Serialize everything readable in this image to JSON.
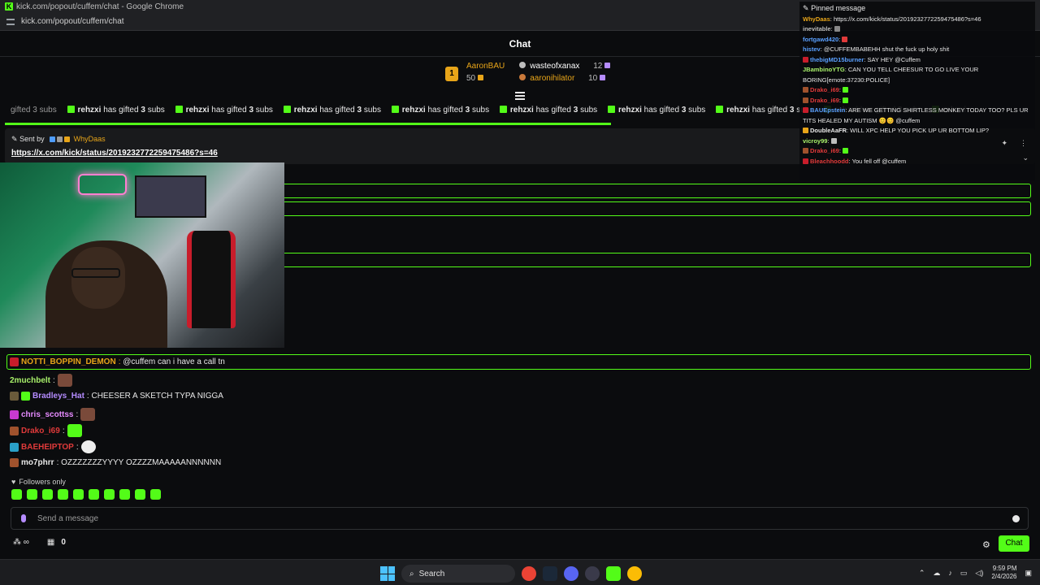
{
  "browser": {
    "title": "kick.com/popout/cuffem/chat - Google Chrome",
    "url": "kick.com/popout/cuffem/chat"
  },
  "chat": {
    "header": "Chat",
    "leaderboard": {
      "first": {
        "name": "AaronBAU",
        "count": "50",
        "rank": "1"
      },
      "second": {
        "name": "wasteofxanax",
        "count": "12"
      },
      "third": {
        "name": "aaronihilator",
        "count": "10"
      }
    },
    "ticker": {
      "prefix": "gifted 3 subs",
      "gifter": "rehzxi",
      "text": "has gifted",
      "count": "3",
      "unit": "subs",
      "tail": "rehzxi"
    },
    "pinned": {
      "sent_by_label": "Sent by",
      "sender": "WhyDaas",
      "link": "https://x.com/kick/status/2019232772259475486?s=46"
    },
    "messages": [
      {
        "user": "NOTTI_BOPPIN_DEMON",
        "color": "#e8a519",
        "text": "@cuffem can i have a call tn",
        "highlight": true
      },
      {
        "user": "2muchbelt",
        "color": "#a8f06a",
        "text": "",
        "emote": true
      },
      {
        "user": "Bradleys_Hat",
        "color": "#b58cff",
        "text": "CHEESER A SKETCH TYPA NIGGA"
      },
      {
        "user": "chris_scottss",
        "color": "#e68bff",
        "text": "",
        "emote": true
      },
      {
        "user": "Drako_i69",
        "color": "#e03a3a",
        "text": "",
        "emote": true
      },
      {
        "user": "BAEHEIPTOP",
        "color": "#e03a3a",
        "text": "",
        "emote": true
      },
      {
        "user": "mo7phrr",
        "color": "#e8e8e8",
        "text": "OZZZZZZZYYYY OZZZZMAAAAANNNNNN"
      }
    ],
    "followers_only": "Followers only",
    "input_placeholder": "Send a message",
    "points": "0",
    "chat_button": "Chat"
  },
  "overlay": {
    "title": "Pinned message",
    "lines": [
      {
        "user": "WhyDaas",
        "color": "#e8a519",
        "text": "https://x.com/kick/status/2019232772259475486?s=46"
      },
      {
        "user": "inevitable",
        "color": "#bdbdbd",
        "text": ""
      },
      {
        "user": "fortgawd420",
        "color": "#5aa0ff",
        "text": ""
      },
      {
        "user": "histev",
        "color": "#5aa0ff",
        "text": "@CUFFEMBABEHH shut the fuck up holy shit"
      },
      {
        "user": "thebigMD15burner",
        "color": "#5aa0ff",
        "text": "SAY HEY @Cuffem"
      },
      {
        "user": "JBambinoYTG",
        "color": "#a8f06a",
        "text": "CAN YOU TELL CHEESUR TO GO LIVE YOUR BORING[emote:37230:POLICE]"
      },
      {
        "user": "Drako_i69",
        "color": "#e03a3a",
        "text": ""
      },
      {
        "user": "Drako_i69",
        "color": "#e03a3a",
        "text": ""
      },
      {
        "user": "BAUEpstein",
        "color": "#5aa0ff",
        "text": "ARE WE GETTING SHIRTLESS MONKEY TODAY TOO? PLS UR TITS HEALED MY AUTISM 😊😊 @cuffem"
      },
      {
        "user": "DoubleAaFR",
        "color": "#e8e8e8",
        "text": "WILL XPC HELP YOU PICK UP UR BOTTOM LIP?"
      },
      {
        "user": "vicroy99",
        "color": "#a8f06a",
        "text": ""
      },
      {
        "user": "Drako_i69",
        "color": "#e03a3a",
        "text": ""
      },
      {
        "user": "Bleachhoodd",
        "color": "#e03a3a",
        "text": "You fell off @cuffem"
      }
    ]
  },
  "taskbar": {
    "search": "Search",
    "time": "9:59 PM",
    "date": "2/4/2026"
  },
  "colors": {
    "accent": "#53fc18",
    "gold": "#e8a519"
  }
}
